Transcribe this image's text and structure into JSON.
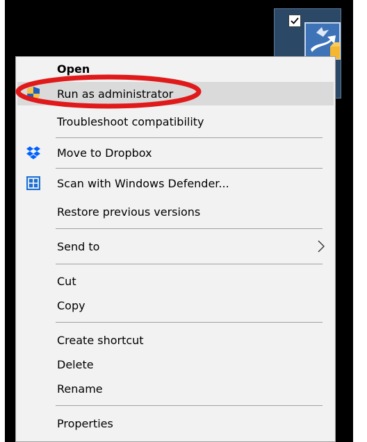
{
  "desktop_icon": {
    "checkbox": "checked",
    "icon": "app-shortcut-icon"
  },
  "colors": {
    "desktop": "#000000",
    "menu_background": "#f2f2f2",
    "menu_highlight": "#dadada",
    "annotation": "#e01a1a"
  },
  "menu": {
    "items": [
      {
        "label": "Open"
      },
      {
        "label": "Run as administrator",
        "icon": "uac-shield-icon",
        "highlighted": true
      },
      {
        "label": "Troubleshoot compatibility"
      },
      {
        "label": "Move to Dropbox",
        "icon": "dropbox-icon"
      },
      {
        "label": "Scan with Windows Defender...",
        "icon": "windows-defender-icon"
      },
      {
        "label": "Restore previous versions"
      },
      {
        "label": "Send to",
        "submenu": true
      },
      {
        "label": "Cut"
      },
      {
        "label": "Copy"
      },
      {
        "label": "Create shortcut"
      },
      {
        "label": "Delete"
      },
      {
        "label": "Rename"
      },
      {
        "label": "Properties"
      }
    ]
  }
}
